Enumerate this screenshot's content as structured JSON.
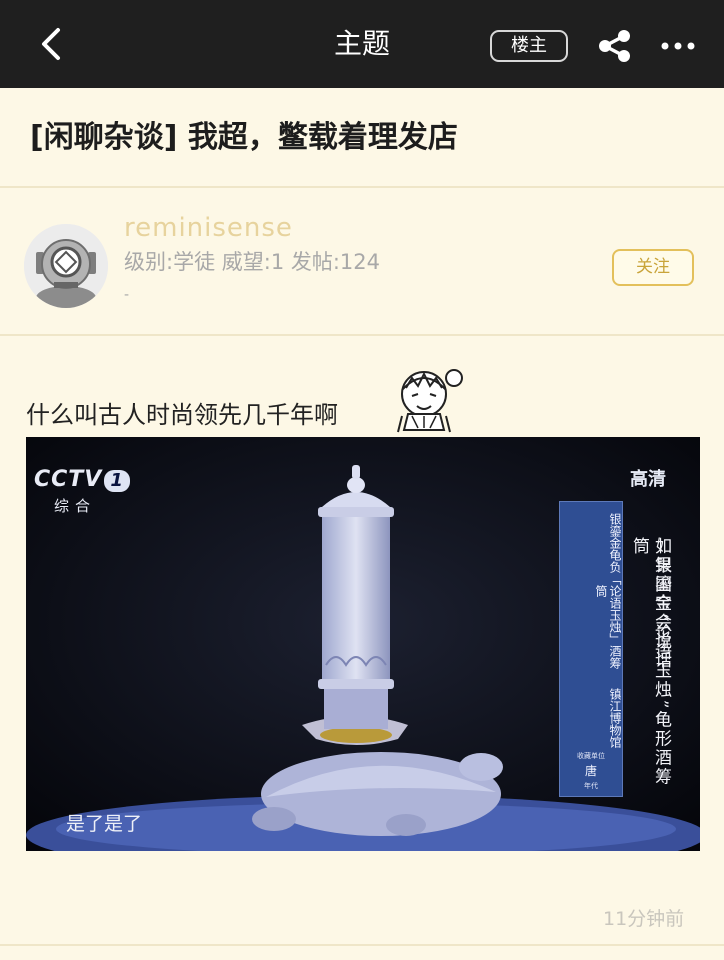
{
  "header": {
    "title": "主题",
    "op_label": "楼主",
    "back_icon": "chevron-left-icon",
    "share_icon": "share-icon",
    "more_icon": "more-dots-icon"
  },
  "thread": {
    "title": "[闲聊杂谈] 我超，鳖载着理发店"
  },
  "author": {
    "username": "reminisense",
    "meta": "级别:学徒 威望:1 发帖:124",
    "extra": "-",
    "follow_label": "关注"
  },
  "post": {
    "text": "什么叫古人时尚领先几千年啊",
    "image": {
      "channel_logo": "CCTV",
      "channel_number": "1",
      "channel_name": "综合",
      "hd_label": "高清",
      "panel_title": "银鎏金龟负「论语玉烛」酒筹筒",
      "panel_museum": "镇江博物馆",
      "panel_holder_label": "收藏单位",
      "panel_era": "唐",
      "panel_era_label": "年代",
      "program_title": "如果国宝会说话",
      "episode_title": "—银鎏金“论语玉烛”龟形酒筹筒",
      "subtitle": "是了是了"
    },
    "timestamp": "11分钟前"
  },
  "colors": {
    "topbar": "#1f1f1f",
    "background": "#fdf8e6",
    "accent": "#e3c05b",
    "username": "#e7d39d"
  }
}
